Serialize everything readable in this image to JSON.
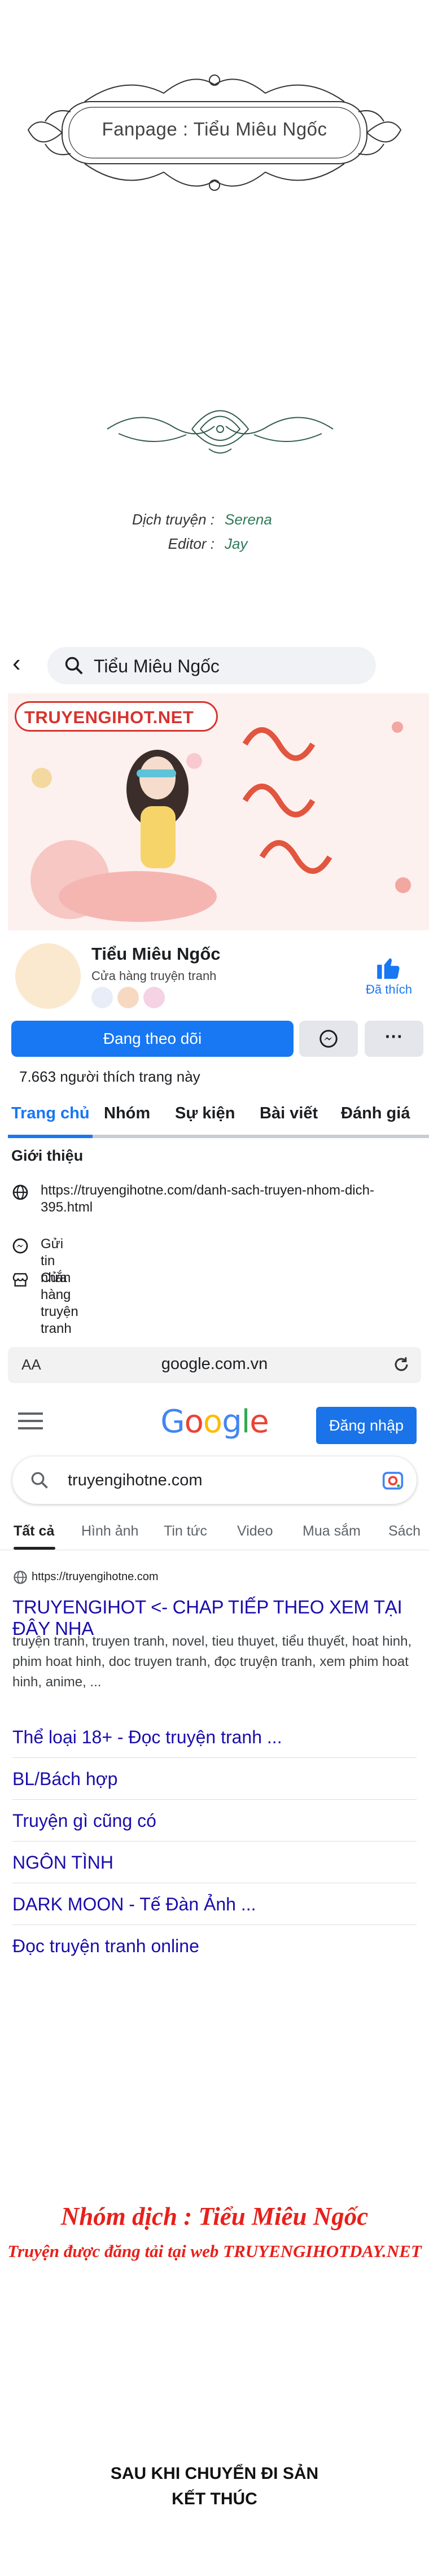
{
  "banner": {
    "fanpage_text": "Fanpage : Tiểu Miêu Ngốc",
    "translator_label": "Dịch truyện :",
    "translator_value": "Serena",
    "editor_label": "Editor :",
    "editor_value": "Jay"
  },
  "facebook": {
    "search_text": "Tiểu Miêu Ngốc",
    "cover_logo": "TRUYENGIHOT.NET",
    "page_name": "Tiểu Miêu Ngốc",
    "category": "Cửa hàng truyện tranh",
    "liked_label": "Đã thích",
    "follow_button": "Đang theo dõi",
    "more_button": "···",
    "likes_text": "7.663 người thích trang này",
    "tabs": [
      "Trang chủ",
      "Nhóm",
      "Sự kiện",
      "Bài viết",
      "Đánh giá"
    ],
    "intro_heading": "Giới thiệu",
    "intro_link": "https://truyengihotne.com/danh-sach-truyen-nhom-dich-395.html",
    "intro_message": "Gửi tin nhắn",
    "intro_category": "Cửa hàng truyện tranh"
  },
  "browser": {
    "aa_label": "AA",
    "url": "google.com.vn"
  },
  "google": {
    "logo": "Google",
    "login_button": "Đăng nhập",
    "search_query": "truyengihotne.com",
    "tabs": [
      "Tất cả",
      "Hình ảnh",
      "Tin tức",
      "Video",
      "Mua sắm",
      "Sách"
    ],
    "result_url": "https://truyengihotne.com",
    "result_title": "TRUYENGIHOT <- CHAP TIẾP THEO XEM TẠI ĐÂY NHA",
    "result_desc": "truyện tranh, truyen tranh, novel, tieu thuyet, tiểu thuyết, hoat hinh, phim hoat hinh, doc truyen tranh, đọc truyện tranh, xem phim hoat hinh, anime, ...",
    "sitelinks": [
      "Thể loại 18+ - Đọc truyện tranh ...",
      "BL/Bách hợp",
      "Truyện gì cũng có",
      "NGÔN TÌNH",
      "DARK MOON - Tế Đàn Ảnh ...",
      "Đọc truyện tranh online"
    ]
  },
  "footer": {
    "team_line": "Nhóm dịch : Tiểu Miêu Ngốc",
    "site_line": "Truyện được đăng tải tại web TRUYENGIHOTDAY.NET",
    "ending_line1": "SAU KHI CHUYỂN ĐI SẢN",
    "ending_line2": "KẾT THÚC"
  },
  "colors": {
    "fb_blue": "#1877f2",
    "google_link": "#1a0dab",
    "credit_red": "#e8201a"
  }
}
